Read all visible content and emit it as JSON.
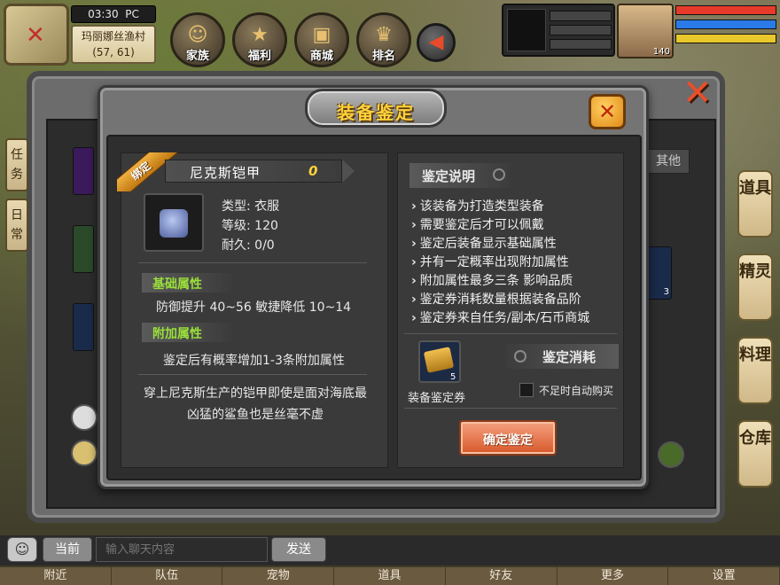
{
  "hud": {
    "time": "03:30",
    "platform": "PC",
    "location": "玛丽娜丝渔村",
    "coords": "(57, 61)",
    "menu": [
      {
        "label": "家族",
        "icon": "family-icon"
      },
      {
        "label": "福利",
        "icon": "star-icon"
      },
      {
        "label": "商城",
        "icon": "shop-icon"
      },
      {
        "label": "排名",
        "icon": "ranking-icon"
      }
    ],
    "player_level": "140",
    "bar_colors": [
      "#e83a2a",
      "#2a7ae8",
      "#e8c82a"
    ]
  },
  "background_window": {
    "left_tabs": [
      "任务",
      "日常"
    ],
    "right_tabs": [
      "道具",
      "精灵",
      "料理",
      "仓库"
    ],
    "other_tab": "其他",
    "peek_count": "3"
  },
  "dialog": {
    "title": "装备鉴定",
    "close_icon": "close-icon",
    "item": {
      "bind_tag": "绑定",
      "name": "尼克斯铠甲",
      "enhance": "0",
      "type_label": "类型: 衣服",
      "level_label": "等级: 120",
      "durability_label": "耐久: 0/0"
    },
    "base_attr": {
      "title": "基础属性",
      "text": "防御提升 40~56 敏捷降低 10~14"
    },
    "extra_attr": {
      "title": "附加属性",
      "text": "鉴定后有概率增加1-3条附加属性"
    },
    "description": "穿上尼克斯生产的铠甲即使是面对海底最凶猛的鲨鱼也是丝毫不虚",
    "help": {
      "title": "鉴定说明",
      "lines": [
        "该装备为打造类型装备",
        "需要鉴定后才可以佩戴",
        "鉴定后装备显示基础属性",
        "并有一定概率出现附加属性",
        "附加属性最多三条 影响品质",
        "鉴定券消耗数量根据装备品阶",
        "鉴定券来自任务/副本/石币商城"
      ]
    },
    "cost": {
      "title": "鉴定消耗",
      "ticket_name": "装备鉴定券",
      "ticket_count": "5",
      "auto_buy": "不足时自动购买"
    },
    "confirm": "确定鉴定"
  },
  "chat": {
    "channel": "当前",
    "placeholder": "输入聊天内容",
    "send": "发送"
  },
  "bottom_nav": [
    "附近",
    "队伍",
    "宠物",
    "道具",
    "好友",
    "更多",
    "设置"
  ]
}
